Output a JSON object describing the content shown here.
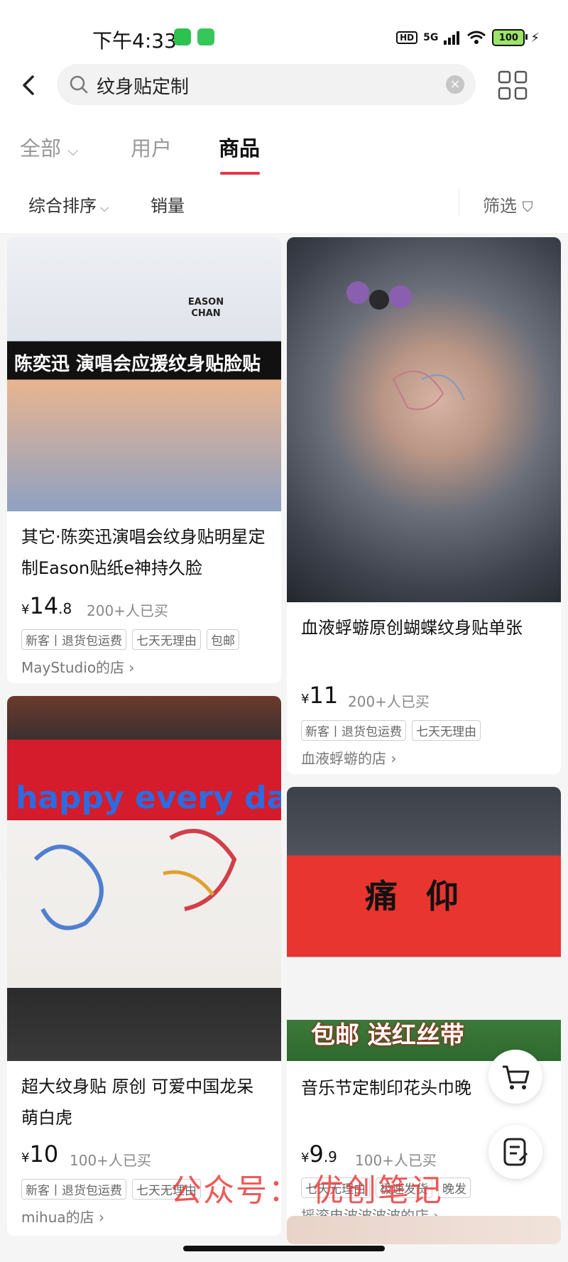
{
  "status_bar": {
    "time": "下午4:33",
    "hd": "HD",
    "network": "5G",
    "battery": "100"
  },
  "search": {
    "query": "纹身贴定制"
  },
  "tabs": [
    {
      "label": "全部"
    },
    {
      "label": "用户"
    },
    {
      "label": "商品"
    }
  ],
  "sort": {
    "comprehensive": "综合排序",
    "sales": "销量",
    "filter": "筛选"
  },
  "products": [
    {
      "title": "其它·陈奕迅演唱会纹身贴明星定制Eason贴纸e神持久脸",
      "price_yen": "¥",
      "price_int": "14",
      "price_dec": ".8",
      "sold": "200+人已买",
      "tags": [
        "新客丨退货包运费",
        "七天无理由",
        "包邮"
      ],
      "shop": "MayStudio的店 ›",
      "image_caption": "陈奕迅 演唱会应援纹身贴脸贴",
      "image_badge": "EASON CHAN"
    },
    {
      "title": "血液蜉蝣原创蝴蝶纹身贴单张",
      "price_yen": "¥",
      "price_int": "11",
      "price_dec": "",
      "sold": "200+人已买",
      "tags": [
        "新客丨退货包运费",
        "七天无理由"
      ],
      "shop": "血液蜉蝣的店 ›"
    },
    {
      "title": "超大纹身贴 原创 可爱中国龙呆萌白虎",
      "price_yen": "¥",
      "price_int": "10",
      "price_dec": "",
      "sold": "100+人已买",
      "tags": [
        "新客丨退货包运费",
        "七天无理由"
      ],
      "shop": "mihua的店 ›",
      "image_caption": "happy every day"
    },
    {
      "title": "音乐节定制印花头巾晚",
      "price_yen": "¥",
      "price_int": "9",
      "price_dec": ".9",
      "sold": "100+人已买",
      "tags": [
        "七天无理由",
        "极速发货",
        "晚发"
      ],
      "shop": "摇滚电波波波波的店 ›",
      "image_caption": "包邮 送红丝带",
      "image_badge": "痛仰"
    }
  ],
  "watermark": "公众号： 优创笔记",
  "icons": {
    "back": "chevron-left-icon",
    "search": "search-icon",
    "clear": "close-circle-icon",
    "grid": "grid-view-icon",
    "cart": "cart-icon",
    "notes": "note-edit-icon"
  },
  "colors": {
    "accent": "#e13a4b",
    "watermark": "#eb3c3c"
  }
}
